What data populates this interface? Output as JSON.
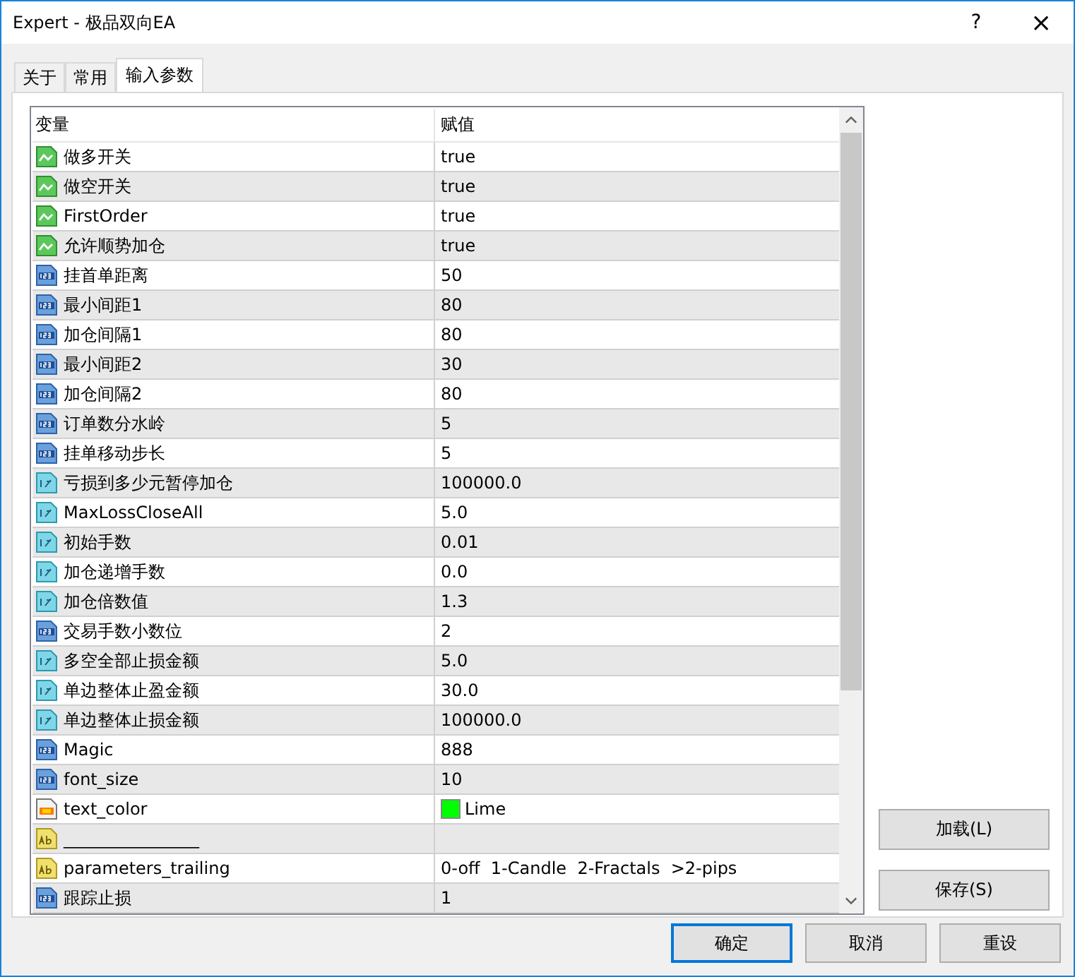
{
  "window": {
    "title": "Expert - 极品双向EA",
    "help": "?",
    "close": "×"
  },
  "tabs": [
    {
      "label": "关于",
      "selected": false
    },
    {
      "label": "常用",
      "selected": false
    },
    {
      "label": "输入参数",
      "selected": true
    }
  ],
  "table": {
    "columns": [
      "变量",
      "赋值"
    ],
    "rows": [
      {
        "kind": "bool",
        "name": "做多开关",
        "value": "true"
      },
      {
        "kind": "bool",
        "name": "做空开关",
        "value": "true"
      },
      {
        "kind": "bool",
        "name": "FirstOrder",
        "value": "true"
      },
      {
        "kind": "bool",
        "name": "允许顺势加仓",
        "value": "true"
      },
      {
        "kind": "int",
        "name": "挂首单距离",
        "value": "50"
      },
      {
        "kind": "int",
        "name": "最小间距1",
        "value": "80"
      },
      {
        "kind": "int",
        "name": "加仓间隔1",
        "value": "80"
      },
      {
        "kind": "int",
        "name": "最小间距2",
        "value": "30"
      },
      {
        "kind": "int",
        "name": "加仓间隔2",
        "value": "80"
      },
      {
        "kind": "int",
        "name": "订单数分水岭",
        "value": "5"
      },
      {
        "kind": "int",
        "name": "挂单移动步长",
        "value": "5"
      },
      {
        "kind": "double",
        "name": "亏损到多少元暂停加仓",
        "value": "100000.0"
      },
      {
        "kind": "double",
        "name": "MaxLossCloseAll",
        "value": "5.0"
      },
      {
        "kind": "double",
        "name": "初始手数",
        "value": "0.01"
      },
      {
        "kind": "double",
        "name": "加仓递增手数",
        "value": "0.0"
      },
      {
        "kind": "double",
        "name": "加仓倍数值",
        "value": "1.3"
      },
      {
        "kind": "int",
        "name": "交易手数小数位",
        "value": "2"
      },
      {
        "kind": "double",
        "name": "多空全部止损金额",
        "value": "5.0"
      },
      {
        "kind": "double",
        "name": "单边整体止盈金额",
        "value": "30.0"
      },
      {
        "kind": "double",
        "name": "单边整体止损金额",
        "value": "100000.0"
      },
      {
        "kind": "int",
        "name": "Magic",
        "value": "888"
      },
      {
        "kind": "int",
        "name": "font_size",
        "value": "10"
      },
      {
        "kind": "color",
        "name": "text_color",
        "value": "Lime",
        "color": "#00ff00"
      },
      {
        "kind": "string",
        "name": "________________"
      },
      {
        "kind": "string",
        "name": "parameters_trailing",
        "value": "0-off  1-Candle  2-Fractals  >2-pips"
      },
      {
        "kind": "int",
        "name": "跟踪止损",
        "value": "1"
      }
    ]
  },
  "side_buttons": [
    "加载(L)",
    "保存(S)"
  ],
  "buttons": [
    {
      "label": "确定",
      "default": true
    },
    {
      "label": "取消",
      "default": false
    },
    {
      "label": "重设",
      "default": false
    }
  ]
}
